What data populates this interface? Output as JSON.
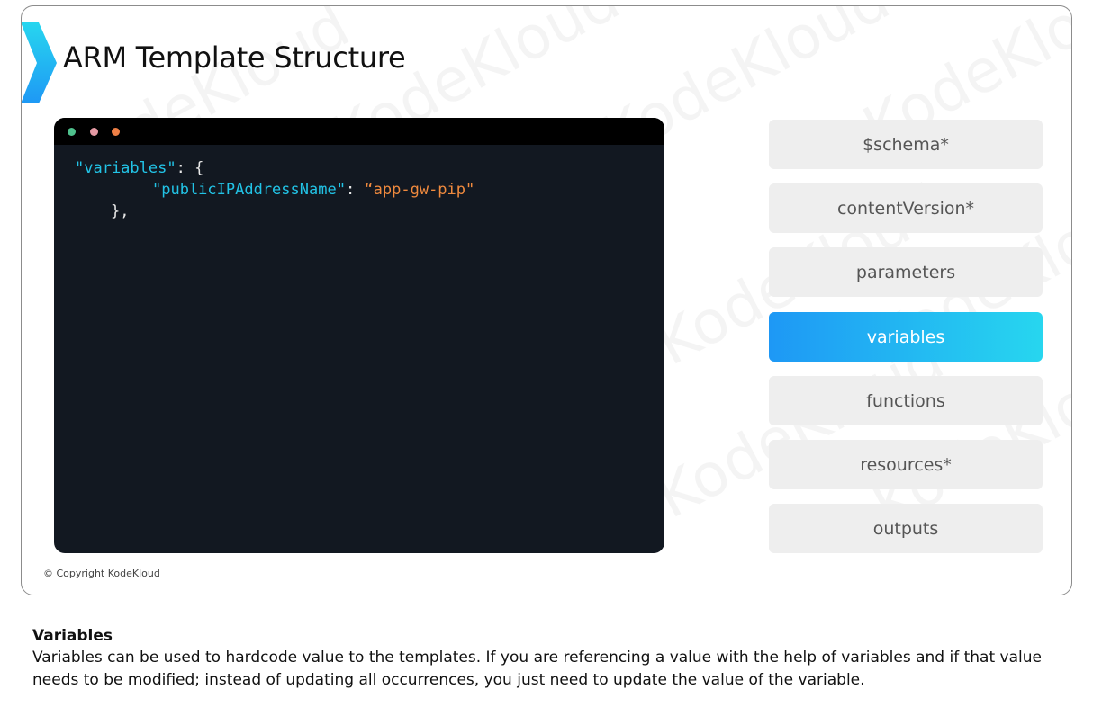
{
  "slide": {
    "title": "ARM Template Structure",
    "copyright": "© Copyright KodeKloud",
    "watermark_text": "KodeKloud",
    "accent_colors": {
      "chevron_start": "#27d6ef",
      "chevron_end": "#1e98f5"
    }
  },
  "code": {
    "line1_key": "\"variables\"",
    "line1_rest": ": {",
    "line2_key": "\"publicIPAddressName\"",
    "line2_colon": ": ",
    "line2_value": "“app-gw-pip\"",
    "line3": "},",
    "dot_colors": [
      "#4fc18d",
      "#e59aa4",
      "#ee7f45"
    ]
  },
  "sections": [
    {
      "label": "$schema*",
      "active": false
    },
    {
      "label": "contentVersion*",
      "active": false
    },
    {
      "label": "parameters",
      "active": false
    },
    {
      "label": "variables",
      "active": true
    },
    {
      "label": "functions",
      "active": false
    },
    {
      "label": "resources*",
      "active": false
    },
    {
      "label": "outputs",
      "active": false
    }
  ],
  "notes": {
    "heading": "Variables",
    "body": "Variables can be used to hardcode value to the templates. If you are referencing a value with the help of variables and if that value needs to be modified; instead of updating all occurrences, you just need to update the value of the variable."
  }
}
